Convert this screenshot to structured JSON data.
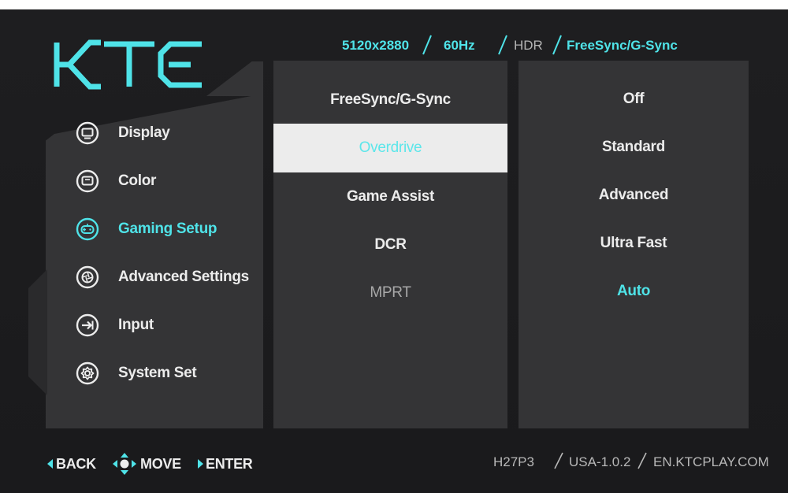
{
  "brand": "KTC",
  "status_bar": {
    "resolution": "5120x2880",
    "refresh_rate": "60Hz",
    "hdr": "HDR",
    "sync": "FreeSync/G-Sync"
  },
  "main_menu": [
    {
      "label": "Display",
      "icon": "monitor-icon",
      "active": false
    },
    {
      "label": "Color",
      "icon": "color-icon",
      "active": false
    },
    {
      "label": "Gaming Setup",
      "icon": "gamepad-icon",
      "active": true
    },
    {
      "label": "Advanced Settings",
      "icon": "aperture-icon",
      "active": false
    },
    {
      "label": "Input",
      "icon": "input-arrow-icon",
      "active": false
    },
    {
      "label": "System Set",
      "icon": "gear-icon",
      "active": false
    }
  ],
  "sub_menu": [
    {
      "label": "FreeSync/G-Sync",
      "state": "normal"
    },
    {
      "label": "Overdrive",
      "state": "selected"
    },
    {
      "label": "Game Assist",
      "state": "normal"
    },
    {
      "label": "DCR",
      "state": "normal"
    },
    {
      "label": "MPRT",
      "state": "disabled"
    }
  ],
  "options": [
    {
      "label": "Off",
      "active": false
    },
    {
      "label": "Standard",
      "active": false
    },
    {
      "label": "Advanced",
      "active": false
    },
    {
      "label": "Ultra Fast",
      "active": false
    },
    {
      "label": "Auto",
      "active": true
    }
  ],
  "footer": {
    "back": "BACK",
    "move": "MOVE",
    "enter": "ENTER",
    "model": "H27P3",
    "firmware": "USA-1.0.2",
    "website": "EN.KTCPLAY.COM"
  },
  "colors": {
    "accent": "#4fe3e8",
    "panel": "#343436",
    "background": "#1c1c1e",
    "text": "#ececec"
  }
}
